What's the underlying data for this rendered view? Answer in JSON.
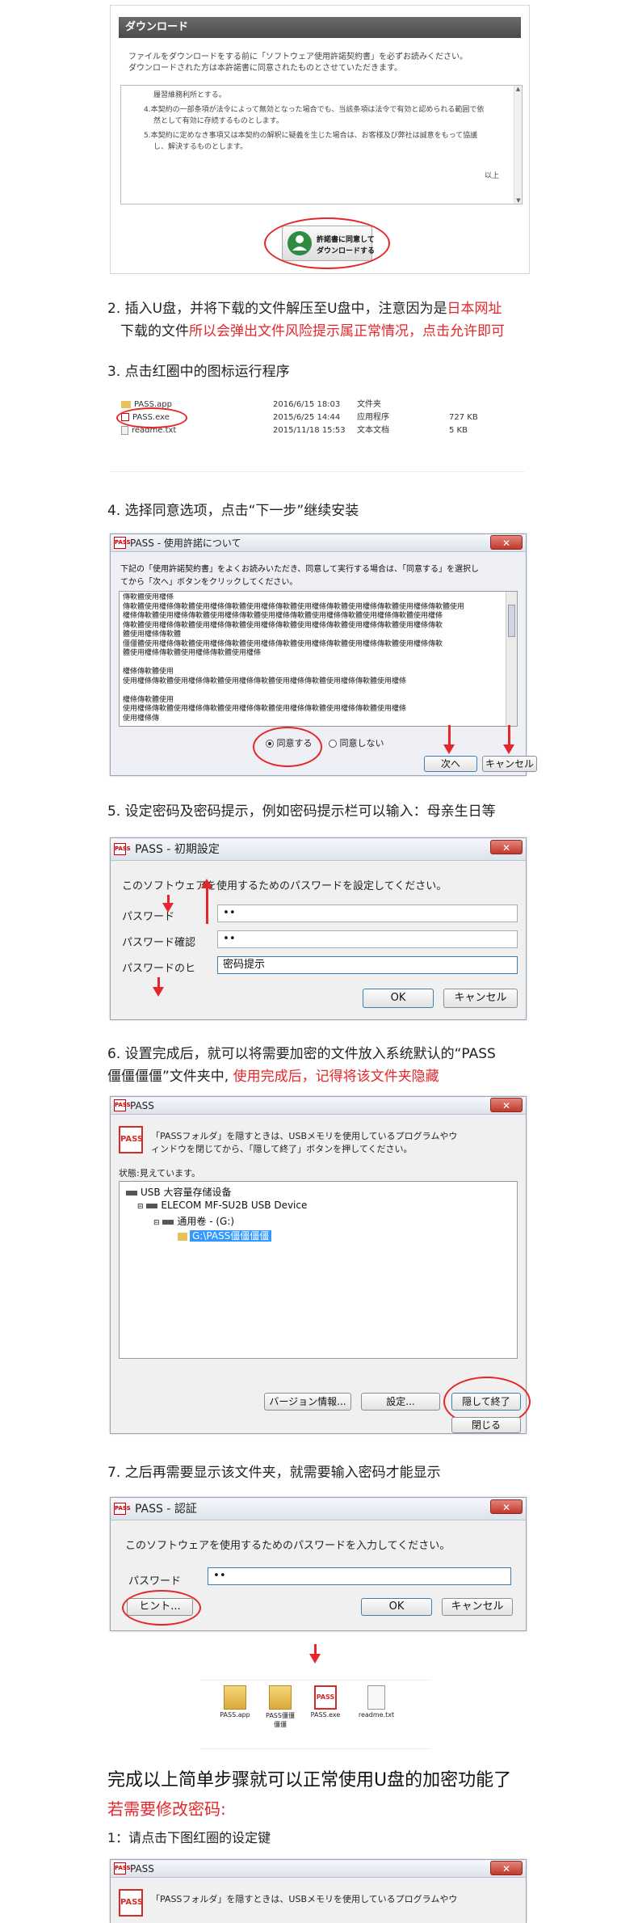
{
  "download_panel": {
    "title": "ダウンロード",
    "intro_line1": "ファイルをダウンロードをする前に「ソフトウェア使用許諾契約書」を必ずお読みください。",
    "intro_line2": "ダウンロードされた方は本許諾書に同意されたものとさせていただきます。",
    "license_lines": [
      "履習維務利所とする。",
      "4.本契約の一部条項が法令によって無効となった場合でも、当該条項は法令で有効と認められる範囲で依",
      "然として有効に存続するものとします。",
      "5.本契約に定めなき事項又は本契約の解釈に疑義を生じた場合は、お客様及び弊社は誠意をもって協議",
      "し、解決するものとします。"
    ],
    "closing": "以上",
    "agree_button_line1": "許諾書に同意して",
    "agree_button_line2": "ダウンロードする"
  },
  "step2": {
    "line1_a": "2. 插入U盘，并将下载的文件解压至U盘中，注意因为是",
    "line1_b": "日本网址",
    "line2_a": "下载的文件",
    "line2_b": "所以会弹出文件风险提示属正常情况，点击允许即可"
  },
  "step3": {
    "text": "3. 点击红圈中的图标运行程序",
    "files": [
      {
        "name": "PASS.app",
        "date": "2016/6/15 18:03",
        "type": "文件夹",
        "size": ""
      },
      {
        "name": "PASS.exe",
        "date": "2015/6/25 14:44",
        "type": "应用程序",
        "size": "727 KB"
      },
      {
        "name": "readme.txt",
        "date": "2015/11/18 15:53",
        "type": "文本文档",
        "size": "5 KB"
      }
    ]
  },
  "step4": {
    "text": "4. 选择同意选项，点击“下一步”继续安装",
    "window_title": "PASS - 使用許諾について",
    "instruction1": "下記の「使用許諾契約書」をよくお読みいただき、同意して実行する場合は、「同意する」を選択し",
    "instruction2": "てから「次へ」ボタンをクリックしてください。",
    "garbled_lines": [
      "傳軟體使用權條",
      "傳軟體使用權條傳軟體使用權條傳軟體使用權條傳軟體使用權條傳軟體使用權條傳軟體使用權條傳軟體使用",
      "權條傳軟體使用權條傳軟體使用權條傳軟體使用權條傳軟體使用權條傳軟體使用權條傳軟體使用權條",
      "傳軟體使用權條傳軟體使用權條傳軟體使用權條傳軟體使用權條傳軟體使用權條傳軟體使用權條傳軟",
      "體使用權條傳軟體",
      "僵僵體使用權條傳軟體使用權條傳軟體使用權條傳軟體使用權條傳軟體使用權條傳軟體使用權條傳軟",
      "體使用權條傳軟體使用權條傳軟體使用權條",
      "",
      "權條傳軟體使用",
      "使用權條傳軟體使用權條傳軟體使用權條傳軟體使用權條傳軟體使用權條傳軟體使用權條",
      "",
      "權條傳軟體使用",
      "使用權條傳軟體使用權條傳軟體使用權條傳軟體使用權條傳軟體使用權條傳軟體使用權條",
      "使用權條傳"
    ],
    "agree": "同意する",
    "disagree": "同意しない",
    "next": "次へ",
    "cancel": "キャンセル"
  },
  "step5": {
    "text": "5. 设定密码及密码提示，例如密码提示栏可以输入：母亲生日等",
    "window_title": "PASS - 初期設定",
    "prompt": "このソフトウェアを使用するためのパスワードを設定してください。",
    "label_password": "パスワード",
    "label_confirm": "パスワード確認",
    "label_hint": "パスワードのヒ",
    "password_value": "••",
    "confirm_value": "••",
    "hint_value": "密码提示",
    "ok": "OK",
    "cancel": "キャンセル"
  },
  "step6": {
    "line1": "6. 设置完成后，就可以将需要加密的文件放入系统默认的“PASS",
    "line2_a": "僵僵僵僵”文件夹中, ",
    "line2_b": "使用完成后，记得将该文件夹隐藏",
    "window_title": "PASS",
    "instruction1": "「PASSフォルダ」を隠すときは、USBメモリを使用しているプログラムやウ",
    "instruction2": "ィンドウを閉じてから、「隠して終了」ボタンを押してください。",
    "status": "状態:見えています。",
    "tree": [
      "USB 大容量存储设备",
      "ELECOM MF-SU2B USB Device",
      "通用卷 - (G:)",
      "G:\\PASS僵僵僵僵"
    ],
    "version_button": "バージョン情報...",
    "settings_button": "設定...",
    "hide_button": "隠して終了",
    "close_button": "閉じる"
  },
  "step7": {
    "text": "7. 之后再需要显示该文件夹，就需要输入密码才能显示",
    "window_title": "PASS - 認証",
    "prompt": "このソフトウェアを使用するためのパスワードを入力してください。",
    "label_password": "パスワード",
    "password_value": "••",
    "hint_button": "ヒント...",
    "ok": "OK",
    "cancel": "キャンセル",
    "folder_icons": [
      {
        "label1": "PASS.app",
        "label2": ""
      },
      {
        "label1": "PASS僵僵",
        "label2": "僵僵"
      },
      {
        "label1": "PASS.exe",
        "label2": ""
      },
      {
        "label1": "readme.txt",
        "label2": ""
      }
    ]
  },
  "conclusion": {
    "heading": "完成以上简单步骤就可以正常使用U盘的加密功能了",
    "modify_heading": "若需要修改密码:",
    "step1_text": "1：请点击下图红圈的设定键"
  },
  "final_window": {
    "title": "PASS",
    "instruction": "「PASSフォルダ」を隠すときは、USBメモリを使用しているプログラムやウ"
  },
  "colors": {
    "accent_red": "#e5262a",
    "selection_blue": "#3399ff"
  }
}
